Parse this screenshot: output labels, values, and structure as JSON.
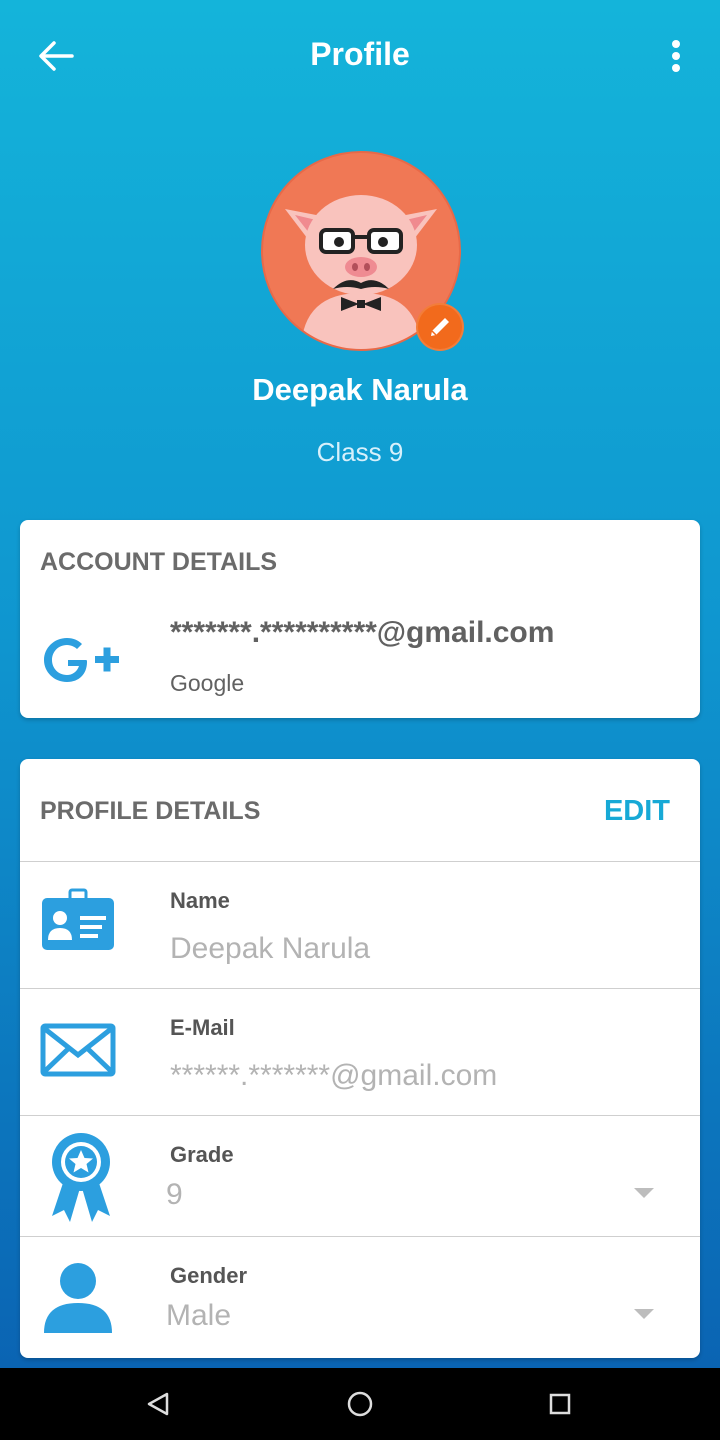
{
  "appbar": {
    "title": "Profile",
    "back_icon": "arrow-back-icon",
    "menu_icon": "more-vert-icon"
  },
  "user": {
    "name": "Deepak Narula",
    "class_label": "Class 9",
    "avatar": "pig-avatar"
  },
  "account": {
    "heading": "ACCOUNT DETAILS",
    "email": "*******.**********@gmail.com",
    "provider": "Google",
    "provider_icon": "google-plus-icon"
  },
  "profile": {
    "heading": "PROFILE DETAILS",
    "edit_label": "EDIT",
    "fields": [
      {
        "label": "Name",
        "value": "Deepak Narula",
        "icon": "id-card-icon"
      },
      {
        "label": "E-Mail",
        "value": "******.*******@gmail.com",
        "icon": "envelope-icon"
      },
      {
        "label": "Grade",
        "value": "9",
        "icon": "award-ribbon-icon"
      },
      {
        "label": "Gender",
        "value": "Male",
        "icon": "person-icon"
      }
    ]
  },
  "colors": {
    "accent": "#17a9d6",
    "icon_blue": "#2c9fdf",
    "edit_badge": "#f26a1c",
    "avatar_bg": "#f07855"
  },
  "navbar": {
    "icons": [
      "back-triangle-icon",
      "home-circle-icon",
      "recents-square-icon"
    ]
  }
}
